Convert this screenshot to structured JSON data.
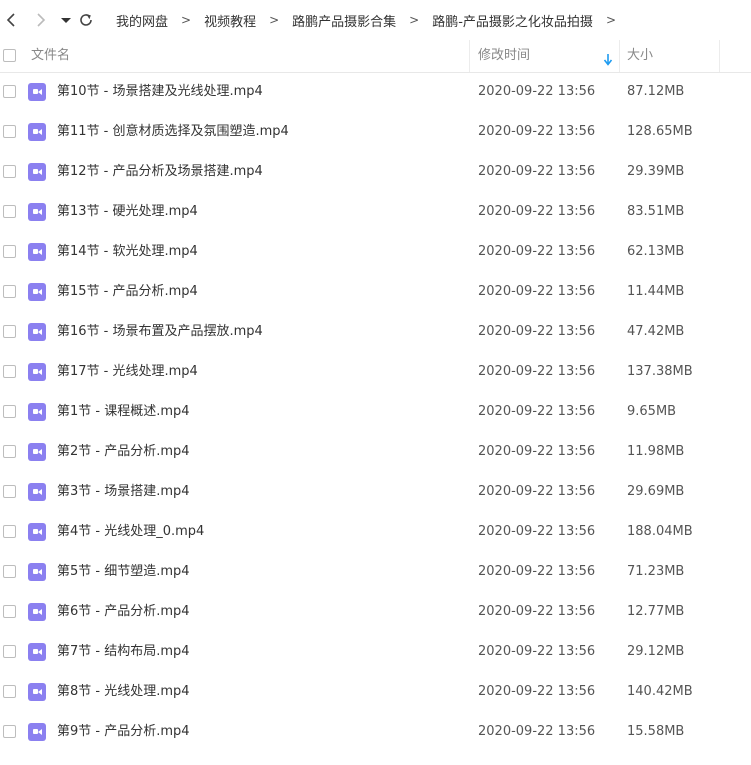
{
  "breadcrumb": [
    "我的网盘",
    "视频教程",
    "路鹏产品摄影合集",
    "路鹏-产品摄影之化妆品拍摄"
  ],
  "breadcrumb_separator": ">",
  "columns": {
    "name": "文件名",
    "modified": "修改时间",
    "size": "大小"
  },
  "sort": {
    "column": "modified",
    "direction": "desc"
  },
  "icon_color": "#8b80f0",
  "sort_arrow_color": "#1e9bf0",
  "files": [
    {
      "name": "第10节 - 场景搭建及光线处理.mp4",
      "modified": "2020-09-22 13:56",
      "size": "87.12MB"
    },
    {
      "name": "第11节 - 创意材质选择及氛围塑造.mp4",
      "modified": "2020-09-22 13:56",
      "size": "128.65MB"
    },
    {
      "name": "第12节 - 产品分析及场景搭建.mp4",
      "modified": "2020-09-22 13:56",
      "size": "29.39MB"
    },
    {
      "name": "第13节 - 硬光处理.mp4",
      "modified": "2020-09-22 13:56",
      "size": "83.51MB"
    },
    {
      "name": "第14节 - 软光处理.mp4",
      "modified": "2020-09-22 13:56",
      "size": "62.13MB"
    },
    {
      "name": "第15节 - 产品分析.mp4",
      "modified": "2020-09-22 13:56",
      "size": "11.44MB"
    },
    {
      "name": "第16节 - 场景布置及产品摆放.mp4",
      "modified": "2020-09-22 13:56",
      "size": "47.42MB"
    },
    {
      "name": "第17节 - 光线处理.mp4",
      "modified": "2020-09-22 13:56",
      "size": "137.38MB"
    },
    {
      "name": "第1节 - 课程概述.mp4",
      "modified": "2020-09-22 13:56",
      "size": "9.65MB"
    },
    {
      "name": "第2节 - 产品分析.mp4",
      "modified": "2020-09-22 13:56",
      "size": "11.98MB"
    },
    {
      "name": "第3节 - 场景搭建.mp4",
      "modified": "2020-09-22 13:56",
      "size": "29.69MB"
    },
    {
      "name": "第4节 - 光线处理_0.mp4",
      "modified": "2020-09-22 13:56",
      "size": "188.04MB"
    },
    {
      "name": "第5节 - 细节塑造.mp4",
      "modified": "2020-09-22 13:56",
      "size": "71.23MB"
    },
    {
      "name": "第6节 - 产品分析.mp4",
      "modified": "2020-09-22 13:56",
      "size": "12.77MB"
    },
    {
      "name": "第7节 - 结构布局.mp4",
      "modified": "2020-09-22 13:56",
      "size": "29.12MB"
    },
    {
      "name": "第8节 - 光线处理.mp4",
      "modified": "2020-09-22 13:56",
      "size": "140.42MB"
    },
    {
      "name": "第9节 - 产品分析.mp4",
      "modified": "2020-09-22 13:56",
      "size": "15.58MB"
    }
  ]
}
